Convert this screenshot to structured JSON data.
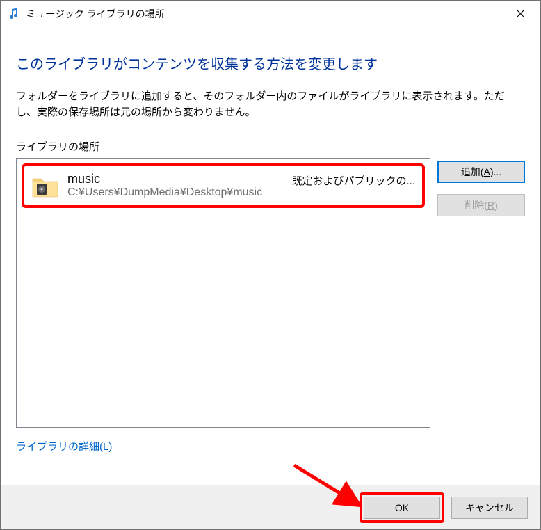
{
  "titlebar": {
    "title": "ミュージック ライブラリの場所"
  },
  "heading": "このライブラリがコンテンツを収集する方法を変更します",
  "description": "フォルダーをライブラリに追加すると、そのフォルダー内のファイルがライブラリに表示されます。ただし、実際の保存場所は元の場所から変わりません。",
  "list_label": "ライブラリの場所",
  "list": {
    "items": [
      {
        "name": "music",
        "path": "C:¥Users¥DumpMedia¥Desktop¥music",
        "status": "既定およびパブリックの..."
      }
    ]
  },
  "buttons": {
    "add_prefix": "追加(",
    "add_u": "A",
    "add_suffix": ")...",
    "remove_prefix": "削除(",
    "remove_u": "R",
    "remove_suffix": ")"
  },
  "detail_link_prefix": "ライブラリの詳細(",
  "detail_link_u": "L",
  "detail_link_suffix": ")",
  "footer": {
    "ok": "OK",
    "cancel": "キャンセル"
  }
}
